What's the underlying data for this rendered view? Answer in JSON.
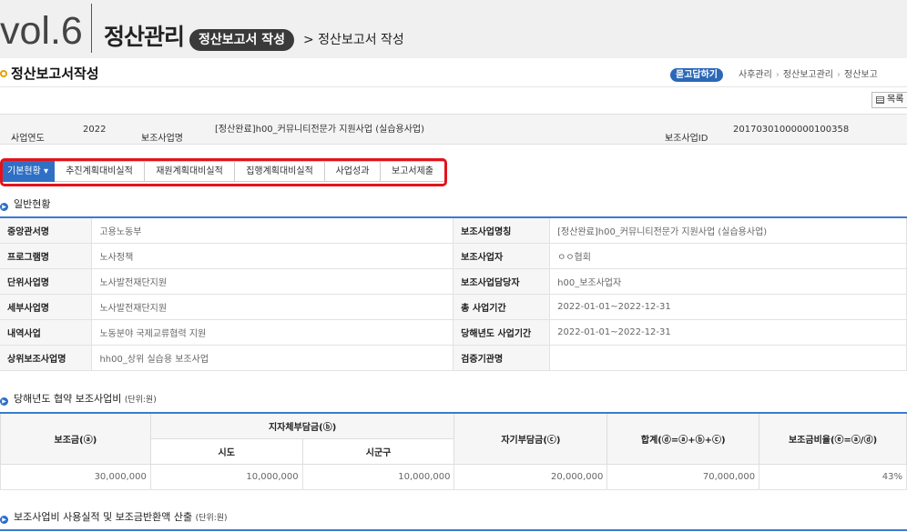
{
  "banner": {
    "vol": "vol.6",
    "title": "정산관리",
    "pill": "정산보고서 작성",
    "sub": "> 정산보고서 작성"
  },
  "header": {
    "title": "정산보고서작성",
    "ask_label": "묻고답하기",
    "breadcrumb": [
      "사후관리",
      "정산보고관리",
      "정산보고"
    ],
    "list_label": "목록"
  },
  "info_bar": {
    "year_label": "사업연도",
    "year_value": "2022",
    "project_label": "보조사업명",
    "project_value": "[정산완료]h00_커뮤니티전문가 지원사업 (실습용사업)",
    "id_label": "보조사업ID",
    "id_value": "20170301000000100358"
  },
  "tabs": [
    "기본현황 ▾",
    "추진계획대비실적",
    "재원계획대비실적",
    "집행계획대비실적",
    "사업성과",
    "보고서제출"
  ],
  "general": {
    "heading": "일반현황",
    "rows": [
      {
        "l1": "중앙관서명",
        "v1": "고용노동부",
        "l2": "보조사업명칭",
        "v2": "[정산완료]h00_커뮤니티전문가 지원사업 (실습용사업)"
      },
      {
        "l1": "프로그램명",
        "v1": "노사정책",
        "l2": "보조사업자",
        "v2": "ㅇㅇ협회"
      },
      {
        "l1": "단위사업명",
        "v1": "노사발전재단지원",
        "l2": "보조사업담당자",
        "v2": "h00_보조사업자"
      },
      {
        "l1": "세부사업명",
        "v1": "노사발전재단지원",
        "l2": "총 사업기간",
        "v2": "2022-01-01~2022-12-31"
      },
      {
        "l1": "내역사업",
        "v1": "노동분야 국제교류협력 지원",
        "l2": "당해년도 사업기간",
        "v2": "2022-01-01~2022-12-31"
      },
      {
        "l1": "상위보조사업명",
        "v1": "hh00_상위 실습용 보조사업",
        "l2": "검증기관명",
        "v2": ""
      }
    ]
  },
  "budget": {
    "heading": "당해년도 협약 보조사업비",
    "unit": "(단위:원)",
    "col_subsidy": "보조금(ⓐ)",
    "col_local": "지자체부담금(ⓑ)",
    "col_city": "시도",
    "col_district": "시군구",
    "col_self": "자기부담금(ⓒ)",
    "col_total": "합계(ⓓ=ⓐ+ⓑ+ⓒ)",
    "col_ratio": "보조금비율(ⓔ=ⓐ/ⓓ)",
    "values": [
      "30,000,000",
      "10,000,000",
      "10,000,000",
      "20,000,000",
      "70,000,000",
      "43%"
    ]
  },
  "usage": {
    "heading": "보조사업비 사용실적 및 보조금반환액 산출",
    "unit": "(단위:원)"
  },
  "colors": {
    "accent": "#2f6fc6",
    "highlight": "#e3131b",
    "bullet": "#e8a000"
  }
}
